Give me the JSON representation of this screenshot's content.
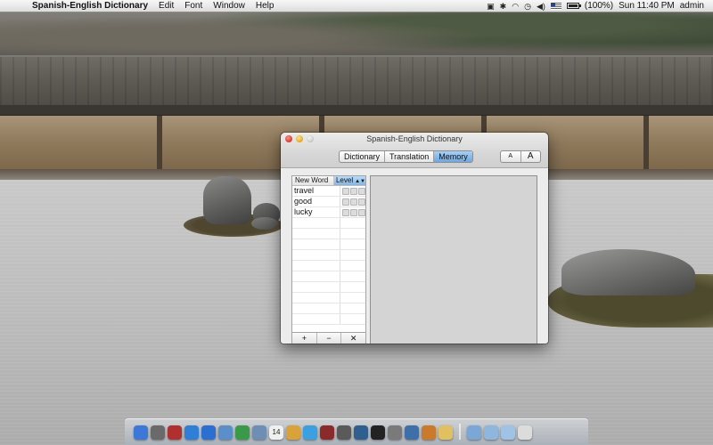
{
  "menubar": {
    "apple_glyph": "",
    "app_name": "Spanish-English Dictionary",
    "items": [
      "Edit",
      "Font",
      "Window",
      "Help"
    ],
    "battery_text": "(100%)",
    "clock": "Sun 11:40 PM",
    "user": "admin",
    "status_icons": [
      "screen-sharing-icon",
      "bluetooth-icon",
      "wifi-icon",
      "time-machine-icon",
      "volume-icon",
      "us-flag-icon",
      "battery-icon"
    ]
  },
  "window": {
    "title": "Spanish-English Dictionary",
    "tabs": [
      "Dictionary",
      "Translation",
      "Memory"
    ],
    "active_tab": "Memory",
    "font_smaller": "A",
    "font_larger": "A"
  },
  "word_table": {
    "col_word": "New Word",
    "col_level": "Level",
    "rows": [
      {
        "word": "travel",
        "level": 0
      },
      {
        "word": "good",
        "level": 0
      },
      {
        "word": "lucky",
        "level": 0
      }
    ],
    "add_label": "+",
    "remove_label": "−",
    "clear_label": "✕"
  },
  "dock": {
    "apps": [
      "finder-icon",
      "launchpad-icon",
      "photo-booth-icon",
      "safari-icon",
      "app-store-icon",
      "mail-icon",
      "facetime-icon",
      "preview-icon",
      "calendar-icon",
      "photos-icon",
      "itunes-icon",
      "dictionary-icon",
      "compass-icon",
      "time-machine-icon",
      "terminal-icon",
      "gear-icon",
      "user-icon",
      "script-icon",
      "notes-icon",
      "folder-icon",
      "documents-icon",
      "downloads-icon",
      "trash-icon"
    ],
    "calendar_day": "14"
  }
}
